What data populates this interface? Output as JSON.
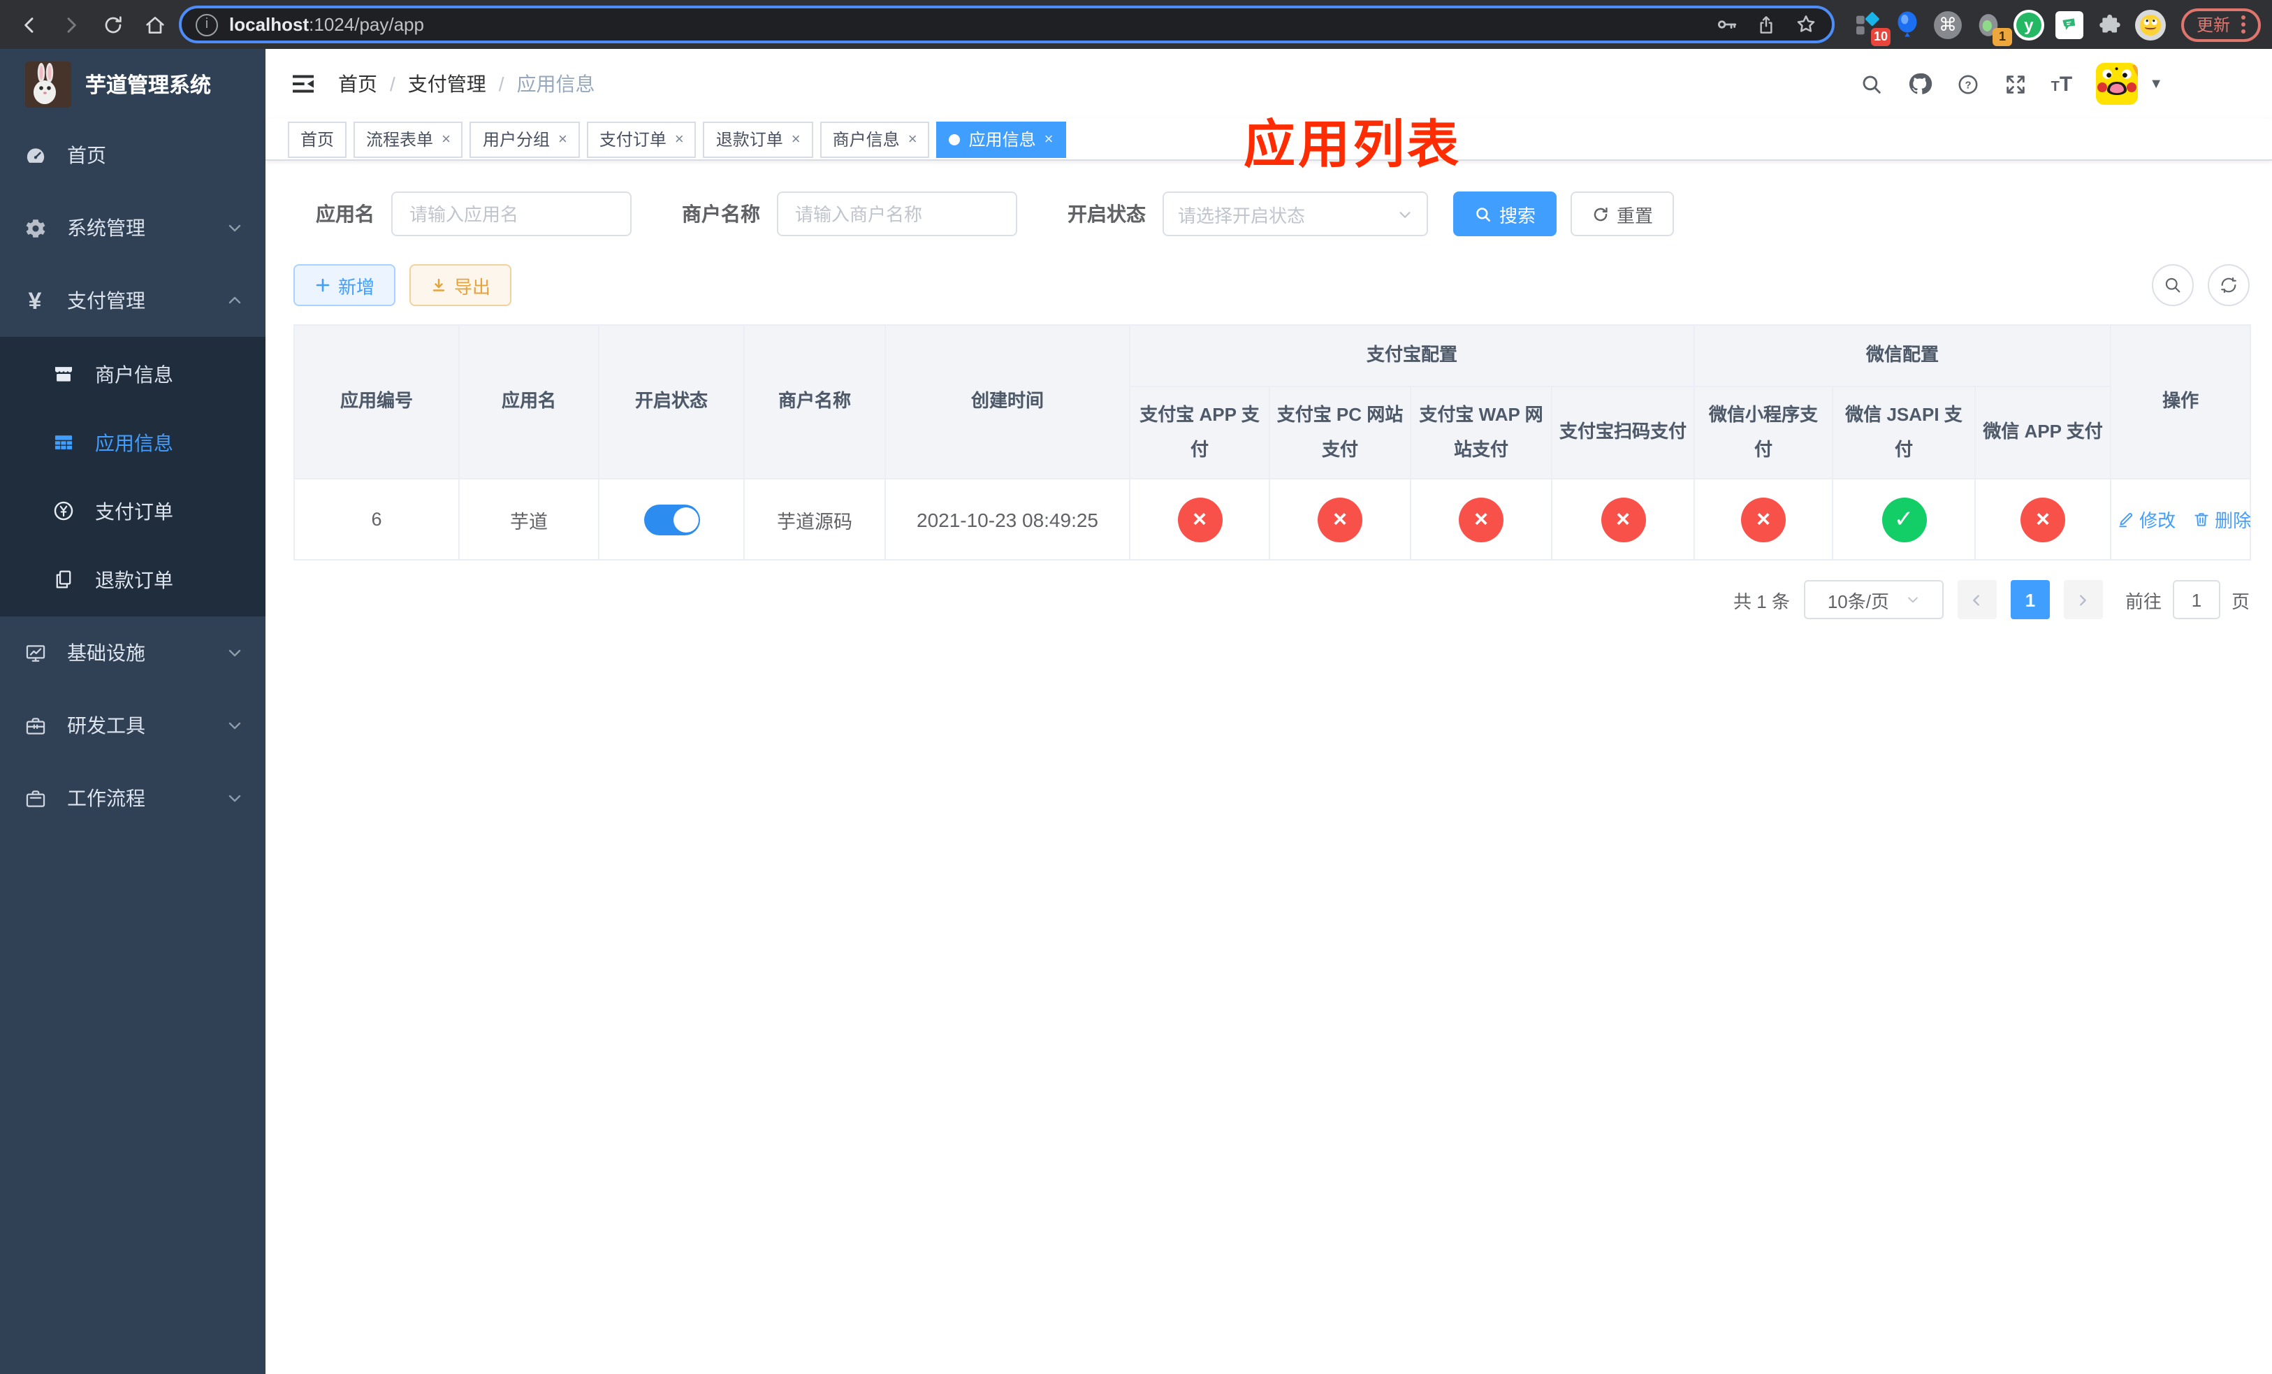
{
  "browser": {
    "url": {
      "host": "localhost",
      "rest": ":1024/pay/app"
    },
    "update_label": "更新",
    "ext_badges": {
      "blocker": "10",
      "counter": "1"
    },
    "ext_y_label": "y"
  },
  "sidebar": {
    "title": "芋道管理系统",
    "menu": [
      {
        "label": "首页"
      },
      {
        "label": "系统管理"
      },
      {
        "label": "支付管理"
      },
      {
        "label": "商户信息"
      },
      {
        "label": "应用信息"
      },
      {
        "label": "支付订单"
      },
      {
        "label": "退款订单"
      },
      {
        "label": "基础设施"
      },
      {
        "label": "研发工具"
      },
      {
        "label": "工作流程"
      }
    ]
  },
  "header": {
    "breadcrumb": [
      "首页",
      "支付管理",
      "应用信息"
    ],
    "annotation": "应用列表"
  },
  "tabs": [
    {
      "label": "首页",
      "closable": false,
      "active": false
    },
    {
      "label": "流程表单",
      "closable": true,
      "active": false
    },
    {
      "label": "用户分组",
      "closable": true,
      "active": false
    },
    {
      "label": "支付订单",
      "closable": true,
      "active": false
    },
    {
      "label": "退款订单",
      "closable": true,
      "active": false
    },
    {
      "label": "商户信息",
      "closable": true,
      "active": false
    },
    {
      "label": "应用信息",
      "closable": true,
      "active": true
    }
  ],
  "filters": {
    "app_name": {
      "label": "应用名",
      "placeholder": "请输入应用名",
      "value": ""
    },
    "merchant": {
      "label": "商户名称",
      "placeholder": "请输入商户名称",
      "value": ""
    },
    "status": {
      "label": "开启状态",
      "placeholder": "请选择开启状态"
    },
    "search_label": "搜索",
    "reset_label": "重置"
  },
  "toolbar": {
    "add_label": "新增",
    "export_label": "导出"
  },
  "table": {
    "groups": {
      "alipay": "支付宝配置",
      "wechat": "微信配置"
    },
    "columns": {
      "id": "应用编号",
      "name": "应用名",
      "status": "开启状态",
      "merchant": "商户名称",
      "created": "创建时间",
      "alipay_app": "支付宝 APP 支付",
      "alipay_pc": "支付宝 PC 网站支付",
      "alipay_wap": "支付宝 WAP 网站支付",
      "alipay_qr": "支付宝扫码支付",
      "wx_mini": "微信小程序支付",
      "wx_jsapi": "微信 JSAPI 支付",
      "wx_app": "微信 APP 支付",
      "actions": "操作"
    },
    "row": {
      "id": "6",
      "name": "芋道",
      "enabled": true,
      "merchant": "芋道源码",
      "created": "2021-10-23 08:49:25",
      "channels": [
        {
          "name": "alipay-app",
          "enabled": false
        },
        {
          "name": "alipay-pc",
          "enabled": false
        },
        {
          "name": "alipay-wap",
          "enabled": false
        },
        {
          "name": "alipay-qr",
          "enabled": false
        },
        {
          "name": "wx-mini",
          "enabled": false
        },
        {
          "name": "wx-jsapi",
          "enabled": true
        },
        {
          "name": "wx-app",
          "enabled": false
        }
      ],
      "edit_label": "修改",
      "delete_label": "删除"
    }
  },
  "pagination": {
    "total": "共 1 条",
    "size": "10条/页",
    "current": "1",
    "goto_label": "前往",
    "goto_value": "1",
    "unit": "页"
  },
  "colors": {
    "primary": "#409eff",
    "success": "#13ce66",
    "danger": "#f8514a",
    "warning": "#e6a23c",
    "annotation": "#fd2c02",
    "sidebar_bg": "#304156",
    "submenu_bg": "#1f2d3d"
  }
}
